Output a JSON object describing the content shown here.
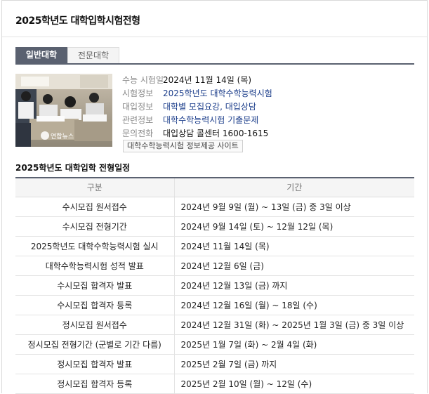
{
  "card": {
    "title": "2025학년도 대학입학시험전형"
  },
  "tabs": [
    {
      "label": "일반대학",
      "active": true
    },
    {
      "label": "전문대학",
      "active": false
    }
  ],
  "photo": {
    "watermark": "연합뉴스"
  },
  "info": [
    {
      "key": "수능 시험일",
      "value": "2024년 11월 14일 (목)",
      "link": false
    },
    {
      "key": "시험정보",
      "value": "2025학년도 대학수학능력시험",
      "link": true
    },
    {
      "key": "대입정보",
      "value": "대학별 모집요강, 대입상담",
      "link": true
    },
    {
      "key": "관련정보",
      "value": "대학수학능력시험 기출문제",
      "link": true
    },
    {
      "key": "문의전화",
      "value": "대입상담 콜센터 1600-1615",
      "link": false
    }
  ],
  "site_button": "대학수학능력시험 정보제공 사이트",
  "schedule": {
    "title": "2025학년도 대학입학 전형일정",
    "headers": [
      "구분",
      "기간"
    ],
    "rows": [
      [
        "수시모집 원서접수",
        "2024년 9월 9일 (월) ~ 13일 (금) 중 3일 이상"
      ],
      [
        "수시모집 전형기간",
        "2024년 9월 14일 (토) ~ 12월 12일 (목)"
      ],
      [
        "2025학년도 대학수학능력시험 실시",
        "2024년 11월 14일 (목)"
      ],
      [
        "대학수학능력시험 성적 발표",
        "2024년 12월 6일 (금)"
      ],
      [
        "수시모집 합격자 발표",
        "2024년 12월 13일 (금) 까지"
      ],
      [
        "수시모집 합격자 등록",
        "2024년 12월 16일 (월) ~ 18일 (수)"
      ],
      [
        "정시모집 원서접수",
        "2024년 12월 31일 (화) ~ 2025년 1월 3일 (금) 중 3일 이상"
      ],
      [
        "정시모집 전형기간 (군별로 기간 다름)",
        "2025년 1월 7일 (화) ~ 2월 4일 (화)"
      ],
      [
        "정시모집 합격자 발표",
        "2025년 2월 7일 (금) 까지"
      ],
      [
        "정시모집 합격자 등록",
        "2025년 2월 10일 (월) ~ 12일 (수)"
      ]
    ]
  }
}
